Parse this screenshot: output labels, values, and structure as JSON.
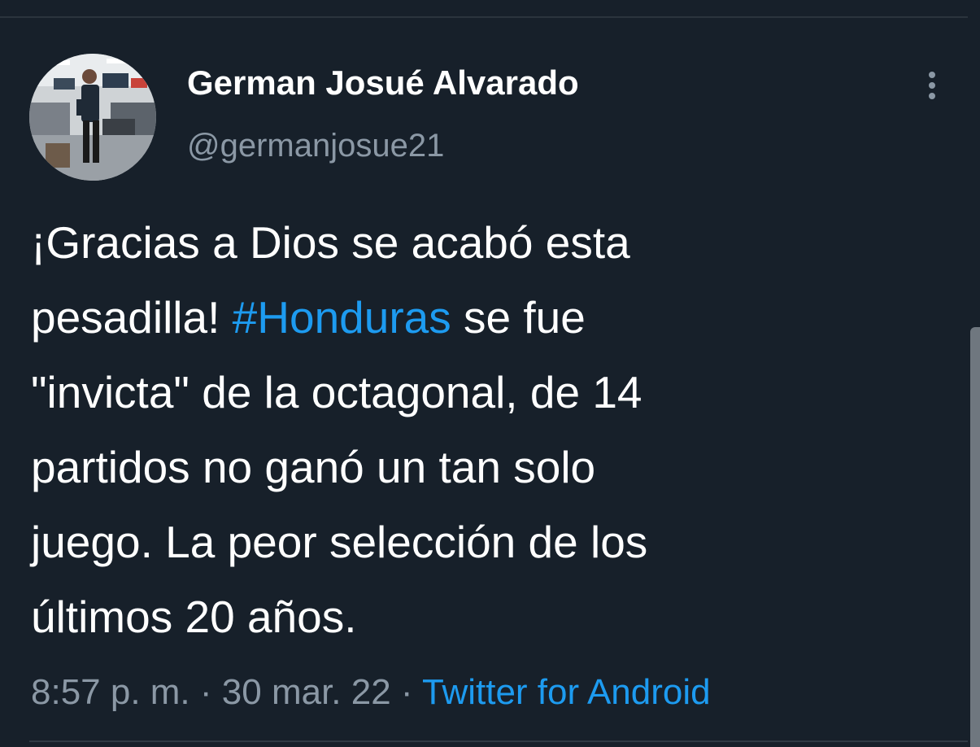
{
  "tweet": {
    "author": {
      "display_name": "German Josué Alvarado",
      "handle": "@germanjosue21",
      "avatar": "profile-photo"
    },
    "more_icon": "more-vertical-icon",
    "text_lines": [
      {
        "before": "¡Gracias a Dios se acabó esta",
        "hashtag": "",
        "after": ""
      },
      {
        "before": "pesadilla! ",
        "hashtag": "#Honduras",
        "after": " se fue"
      },
      {
        "before": "\"invicta\" de la octagonal, de 14",
        "hashtag": "",
        "after": ""
      },
      {
        "before": "partidos no ganó un tan solo",
        "hashtag": "",
        "after": ""
      },
      {
        "before": "juego. La peor selección de los",
        "hashtag": "",
        "after": ""
      },
      {
        "before": "últimos 20 años.",
        "hashtag": "",
        "after": ""
      }
    ],
    "time": "8:57 p. m.",
    "separator": " · ",
    "date": "30 mar. 22",
    "source": "Twitter for Android"
  },
  "colors": {
    "background": "#17202a",
    "text": "#ffffff",
    "secondary_text": "#8b98a5",
    "link": "#1d9bf0"
  }
}
